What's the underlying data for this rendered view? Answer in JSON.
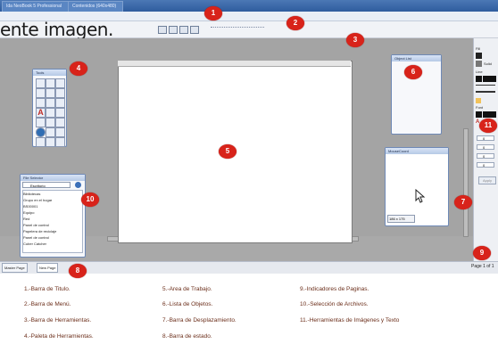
{
  "app": {
    "tabs": [
      "Ida NeoBook 5 Professional",
      "Contenidos (640x480)"
    ],
    "overlay_text": "ente imagen."
  },
  "panels": {
    "tools_title": "Tools",
    "object_list_title": "Object List",
    "mouse_coords_title": "MouseCoord",
    "mouse_coords_value": "186 x 175",
    "file_selector_title": "File Selector",
    "file_selector_drive": "Escritorio",
    "file_items": [
      "Bibliotecas",
      "Grupo en el hogar",
      "BS00001",
      "Equipo",
      "Red",
      "Panel de control",
      "Papelera de reciclaje",
      "Panel de control",
      "Cuber Catcher"
    ]
  },
  "right_panel": {
    "fill_label": "Fill",
    "solid_label": "Solid",
    "line_label": "Line",
    "font_label": "Font",
    "abc_label": "Abc",
    "apply_label": "Apply",
    "field_values": [
      "0",
      "0",
      "0",
      "0"
    ]
  },
  "statusbar": {
    "tabs": [
      "Master Page",
      "New Page"
    ],
    "page_indicator": "Page 1 of 1"
  },
  "badges": [
    "1",
    "2",
    "3",
    "4",
    "5",
    "6",
    "7",
    "8",
    "9",
    "10",
    "11"
  ],
  "legend": {
    "col1": [
      "1.-Barra de Titulo.",
      "2.-Barra de Menú.",
      "3.-Barra de Herramientas.",
      "4.-Paleta de Herramientas."
    ],
    "col2": [
      "5.-Area de Trabajo.",
      "6.-Lista de Objetos.",
      "7.-Barra de Desplazamiento.",
      "8.-Barra de estado."
    ],
    "col3": [
      "9.-Indicadores de Paginas.",
      "10.-Selección de Archivos.",
      "11.-Herramientas de Imágenes y Texto"
    ]
  }
}
